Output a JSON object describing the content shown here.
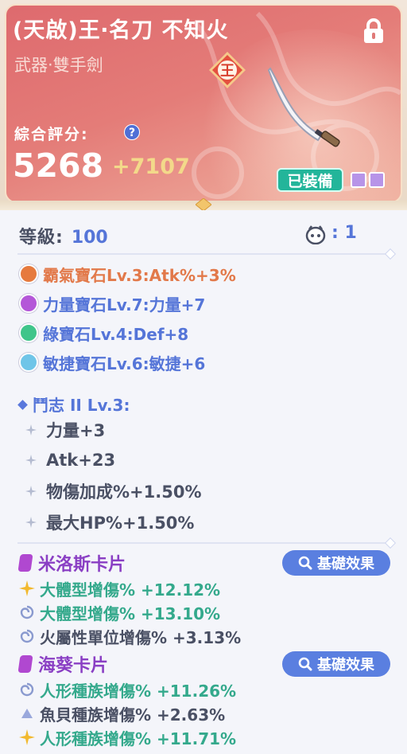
{
  "item": {
    "title": "(天啟)王‧名刀 不知火",
    "subtitle": "武器‧雙手劍",
    "rank_glyph": "王",
    "score_label": "綜合評分:",
    "score": "5268",
    "score_bonus": "+7107",
    "equipped_label": "已裝備"
  },
  "stats": {
    "level_label": "等級:",
    "level_value": "100",
    "refine_value": ": 1"
  },
  "gems": [
    {
      "text": "霸氣寶石Lv.3:Atk%+3%",
      "color": "#e2794a",
      "dot": "#e67a3e"
    },
    {
      "text": "力量寶石Lv.7:力量+7",
      "color": "#5575d8",
      "dot": "#b457d8"
    },
    {
      "text": "綠寶石Lv.4:Def+8",
      "color": "#5575d8",
      "dot": "#3fc58a"
    },
    {
      "text": "敏捷寶石Lv.6:敏捷+6",
      "color": "#5575d8",
      "dot": "#6fc5e8"
    }
  ],
  "set_bonus": {
    "title": "鬥志 II Lv.3:",
    "lines": [
      "力量+3",
      "Atk+23",
      "物傷加成%+1.50%",
      "最大HP%+1.50%"
    ]
  },
  "cards": [
    {
      "name": "米洛斯卡片",
      "button": "基礎效果",
      "effects": [
        {
          "icon": "star-icon",
          "text": "大體型增傷% +12.12%",
          "style": "green"
        },
        {
          "icon": "swirl-icon",
          "text": "大體型增傷% +13.10%",
          "style": "green"
        },
        {
          "icon": "swirl-icon",
          "text": "火屬性單位增傷% +3.13%",
          "style": "dark"
        }
      ]
    },
    {
      "name": "海葵卡片",
      "button": "基礎效果",
      "effects": [
        {
          "icon": "swirl-icon",
          "text": "人形種族增傷% +11.26%",
          "style": "green"
        },
        {
          "icon": "triangle-icon",
          "text": "魚貝種族增傷% +2.63%",
          "style": "dark"
        },
        {
          "icon": "star-icon",
          "text": "人形種族增傷% +11.71%",
          "style": "green"
        }
      ]
    }
  ]
}
